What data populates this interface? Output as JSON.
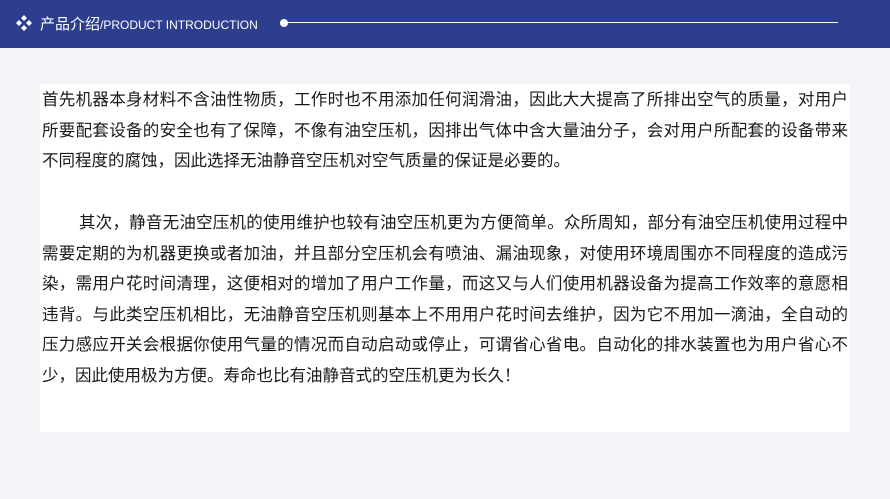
{
  "header": {
    "title_cn": "产品介绍",
    "title_en": "/PRODUCT INTRODUCTION",
    "icon": "diamond-cluster-icon",
    "background_color": "#2d3e8f"
  },
  "content": {
    "paragraphs": [
      "首先机器本身材料不含油性物质，工作时也不用添加任何润滑油，因此大大提高了所排出空气的质量，对用户所要配套设备的安全也有了保障，不像有油空压机，因排出气体中含大量油分子，会对用户所配套的设备带来不同程度的腐蚀，因此选择无油静音空压机对空气质量的保证是必要的。",
      "其次，静音无油空压机的使用维护也较有油空压机更为方便简单。众所周知，部分有油空压机使用过程中需要定期的为机器更换或者加油，并且部分空压机会有喷油、漏油现象，对使用环境周围亦不同程度的造成污染，需用户花时间清理，这便相对的增加了用户工作量，而这又与人们使用机器设备为提高工作效率的意愿相违背。与此类空压机相比，无油静音空压机则基本上不用用户花时间去维护，因为它不用加一滴油，全自动的压力感应开关会根据你使用气量的情况而自动启动或停止，可谓省心省电。自动化的排水装置也为用户省心不少，因此使用极为方便。寿命也比有油静音式的空压机更为长久！"
    ]
  }
}
